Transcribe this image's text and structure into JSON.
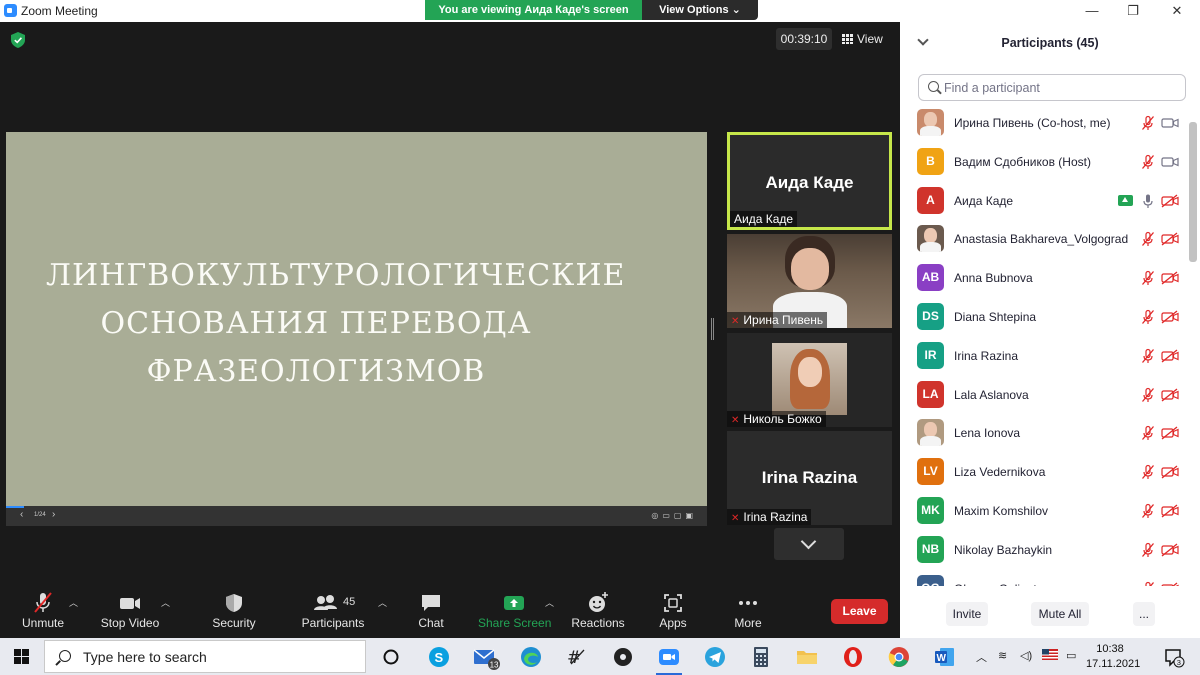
{
  "window": {
    "title": "Zoom Meeting",
    "viewing_banner": "You are viewing Аида Каде's screen",
    "view_options": "View Options",
    "controls": {
      "minimize": "—",
      "restore": "❐",
      "close": "✕"
    }
  },
  "meeting": {
    "timer": "00:39:10",
    "view_label": "View",
    "slide": {
      "title_lines": [
        "Лингвокультурологические",
        "основания перевода",
        "фразеологизмов"
      ],
      "page": "1/24"
    },
    "tiles": [
      {
        "center_name": "Аида Каде",
        "label": "Аида Каде",
        "muted": false,
        "highlight_color": "#c6e74a"
      },
      {
        "center_name": "",
        "label": "Ирина Пивень",
        "muted": true
      },
      {
        "center_name": "",
        "label": "Николь Божко",
        "muted": true
      },
      {
        "center_name": "Irina Razina",
        "label": "Irina Razina",
        "muted": true
      }
    ]
  },
  "toolbar": {
    "unmute": "Unmute",
    "stop_video": "Stop Video",
    "security": "Security",
    "participants": "Participants",
    "participants_count": "45",
    "chat": "Chat",
    "share_screen": "Share Screen",
    "reactions": "Reactions",
    "apps": "Apps",
    "more": "More",
    "leave": "Leave",
    "share_color": "#23a455",
    "leave_color": "#d52b2b"
  },
  "panel": {
    "title": "Participants (45)",
    "search_placeholder": "Find a participant",
    "participants": [
      {
        "name": "Ирина Пивень (Co-host, me)",
        "initials": "",
        "avatar_color": "#c98a6b",
        "photo": true,
        "mic_muted": true,
        "video_on": true,
        "sharing": false
      },
      {
        "name": "Вадим Сдобников (Host)",
        "initials": "В",
        "avatar_color": "#f0a314",
        "photo": false,
        "mic_muted": true,
        "video_on": true,
        "sharing": false
      },
      {
        "name": "Аида Каде",
        "initials": "А",
        "avatar_color": "#d0342c",
        "photo": false,
        "mic_muted": false,
        "video_on": false,
        "sharing": true
      },
      {
        "name": "Anastasia Bakhareva_Volgograd",
        "initials": "",
        "avatar_color": "#6b5a4e",
        "photo": true,
        "mic_muted": true,
        "video_on": false,
        "sharing": false
      },
      {
        "name": "Anna Bubnova",
        "initials": "AB",
        "avatar_color": "#8a3fc4",
        "photo": false,
        "mic_muted": true,
        "video_on": false,
        "sharing": false
      },
      {
        "name": "Diana Shtepina",
        "initials": "DS",
        "avatar_color": "#16a085",
        "photo": false,
        "mic_muted": true,
        "video_on": false,
        "sharing": false
      },
      {
        "name": "Irina Razina",
        "initials": "IR",
        "avatar_color": "#16a085",
        "photo": false,
        "mic_muted": true,
        "video_on": false,
        "sharing": false
      },
      {
        "name": "Lala Aslanova",
        "initials": "LA",
        "avatar_color": "#d0342c",
        "photo": false,
        "mic_muted": true,
        "video_on": false,
        "sharing": false
      },
      {
        "name": "Lena Ionova",
        "initials": "",
        "avatar_color": "#b09a80",
        "photo": true,
        "mic_muted": true,
        "video_on": false,
        "sharing": false
      },
      {
        "name": "Liza Vedernikova",
        "initials": "LV",
        "avatar_color": "#e0700e",
        "photo": false,
        "mic_muted": true,
        "video_on": false,
        "sharing": false
      },
      {
        "name": "Maxim Komshilov",
        "initials": "MK",
        "avatar_color": "#23a455",
        "photo": false,
        "mic_muted": true,
        "video_on": false,
        "sharing": false
      },
      {
        "name": "Nikolay Bazhaykin",
        "initials": "NB",
        "avatar_color": "#23a455",
        "photo": false,
        "mic_muted": true,
        "video_on": false,
        "sharing": false
      },
      {
        "name": "Oksana Golinets",
        "initials": "OG",
        "avatar_color": "#3b5f8c",
        "photo": false,
        "mic_muted": true,
        "video_on": false,
        "sharing": false
      }
    ],
    "invite": "Invite",
    "mute_all": "Mute All",
    "more": "..."
  },
  "taskbar": {
    "search_placeholder": "Type here to search",
    "mail_badge": "13",
    "apps": [
      "cortana-icon",
      "skype-icon",
      "mail-icon",
      "edge-icon",
      "handwriting-app-icon",
      "media-icon",
      "zoom-icon",
      "telegram-icon",
      "calculator-icon",
      "file-explorer-icon",
      "opera-icon",
      "chrome-icon",
      "word-icon"
    ],
    "time": "10:38",
    "date": "17.11.2021",
    "notifications": "3"
  }
}
